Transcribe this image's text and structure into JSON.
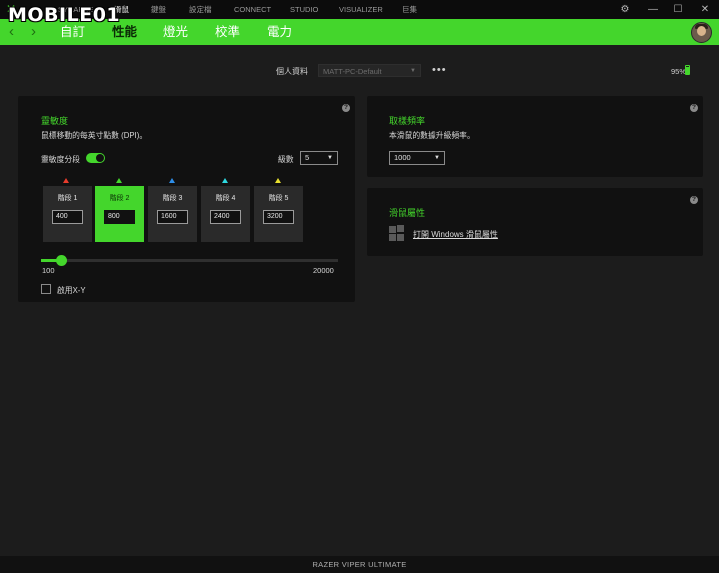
{
  "app": {
    "logo_glyph": "✕",
    "watermark": "MOBILE01",
    "device_name": "RAZER VIPER ULTIMATE"
  },
  "topnav": [
    {
      "label": "SYNAPSE"
    },
    {
      "label": "滑鼠"
    },
    {
      "label": "鍵盤"
    },
    {
      "label": "設定檔"
    },
    {
      "label": "CONNECT"
    },
    {
      "label": "STUDIO"
    },
    {
      "label": "VISUALIZER"
    },
    {
      "label": "巨集"
    }
  ],
  "window_controls": {
    "settings": "⚙",
    "minimize": "—",
    "maximize": "☐",
    "close": "✕"
  },
  "subnav": {
    "back": "‹",
    "forward": "›",
    "tabs": [
      {
        "label": "自訂"
      },
      {
        "label": "性能"
      },
      {
        "label": "燈光"
      },
      {
        "label": "校準"
      },
      {
        "label": "電力"
      }
    ],
    "active_tab": "性能"
  },
  "profile": {
    "label": "個人資料",
    "selected": "MATT-PC-Default",
    "more": "•••"
  },
  "battery": {
    "text": "95%",
    "level": 0.95
  },
  "sensitivity": {
    "help": "?",
    "title": "靈敏度",
    "description": "鼠標移動的每英寸點數 (DPI)。",
    "stages_label": "靈敏度分段",
    "stages_enabled": true,
    "levels_label": "級數",
    "levels_value": "5",
    "stages": [
      {
        "label": "階段 1",
        "value": "400",
        "color": "#e83c2c"
      },
      {
        "label": "階段 2",
        "value": "800",
        "color": "#44d62c"
      },
      {
        "label": "階段 3",
        "value": "1600",
        "color": "#2e8ee8"
      },
      {
        "label": "階段 4",
        "value": "2400",
        "color": "#2ed8e0"
      },
      {
        "label": "階段 5",
        "value": "3200",
        "color": "#e8e02e"
      }
    ],
    "active_stage": 1,
    "slider": {
      "min_label": "100",
      "max_label": "20000",
      "min": 100,
      "max": 20000,
      "value": 800
    },
    "xy_label": "啟用X-Y",
    "xy_enabled": false
  },
  "polling": {
    "help": "?",
    "title": "取樣頻率",
    "description": "本滑鼠的數據升級頻率。",
    "value": "1000"
  },
  "mouse_props": {
    "help": "?",
    "title": "滑鼠屬性",
    "link": "打開 Windows 滑鼠屬性"
  },
  "colors": {
    "accent": "#44d62c",
    "background": "#1c1c1c",
    "panel": "#111111"
  }
}
